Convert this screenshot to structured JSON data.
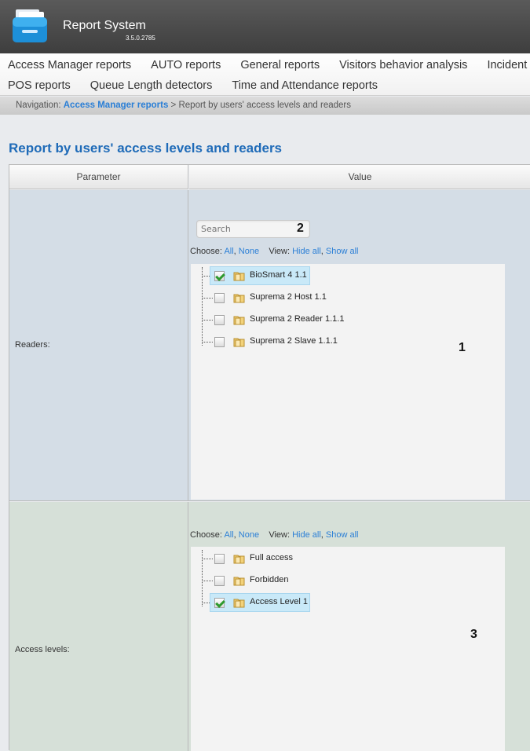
{
  "app": {
    "title": "Report System",
    "version": "3.5.0.2785"
  },
  "menu": {
    "row1": [
      "Access Manager reports",
      "AUTO reports",
      "General reports",
      "Visitors behavior analysis",
      "Incident"
    ],
    "row2": [
      "POS reports",
      "Queue Length detectors",
      "Time and Attendance reports"
    ]
  },
  "navigation": {
    "prefix": "Navigation:",
    "link": "Access Manager reports",
    "separator": ">",
    "current": "Report by users' access levels and readers"
  },
  "page_title": "Report by users' access levels and readers",
  "table": {
    "col_parameter": "Parameter",
    "col_value": "Value",
    "readers": {
      "label": "Readers:",
      "search_placeholder": "Search",
      "choose_label": "Choose:",
      "choose_all": "All",
      "choose_none": "None",
      "view_label": "View:",
      "view_hide_all": "Hide all",
      "view_show_all": "Show all",
      "items": [
        {
          "label": "BioSmart 4 1.1",
          "checked": true,
          "selected": true
        },
        {
          "label": "Suprema 2 Host 1.1",
          "checked": false,
          "selected": false
        },
        {
          "label": "Suprema 2 Reader 1.1.1",
          "checked": false,
          "selected": false
        },
        {
          "label": "Suprema 2 Slave 1.1.1",
          "checked": false,
          "selected": false
        }
      ]
    },
    "access_levels": {
      "label": "Access levels:",
      "choose_label": "Choose:",
      "choose_all": "All",
      "choose_none": "None",
      "view_label": "View:",
      "view_hide_all": "Hide all",
      "view_show_all": "Show all",
      "items": [
        {
          "label": "Full access",
          "checked": false,
          "selected": false
        },
        {
          "label": "Forbidden",
          "checked": false,
          "selected": false
        },
        {
          "label": "Access Level 1",
          "checked": true,
          "selected": true
        }
      ]
    }
  },
  "callouts": {
    "one": "1",
    "two": "2",
    "three": "3"
  },
  "colors": {
    "header": "#4a4a4a",
    "link": "#2b7fd6",
    "title": "#1f6bb8",
    "readers_bg": "#d4dde6",
    "levels_bg": "#d6e0d8",
    "selection": "#c9e9f8",
    "check": "#2e9a2e"
  }
}
